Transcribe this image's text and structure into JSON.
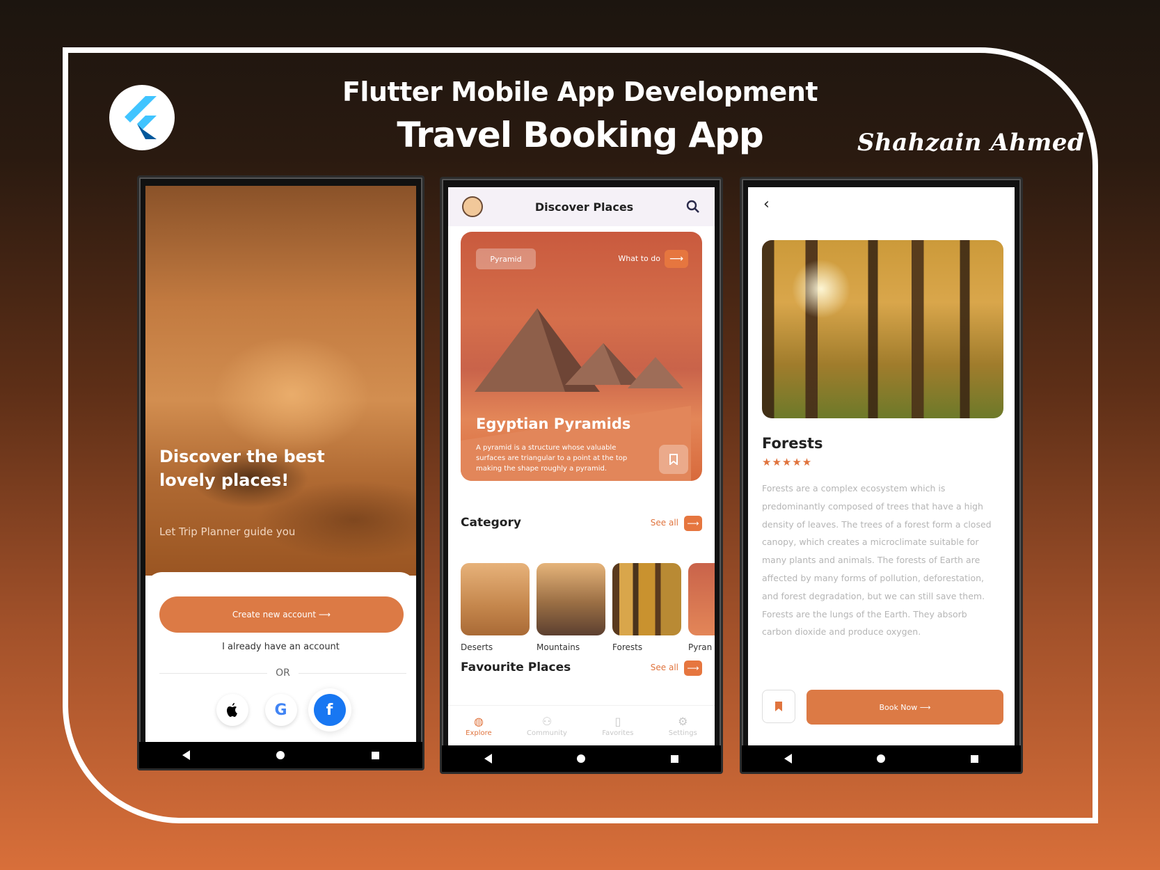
{
  "header": {
    "title_line1": "Flutter Mobile App Development",
    "title_line2": "Travel Booking App",
    "author": "Shahzain Ahmed",
    "logo_icon": "flutter-logo"
  },
  "phone1": {
    "headline": "Discover the best lovely places!",
    "subtitle": "Let Trip Planner guide you",
    "create_button": "Create new account ⟶",
    "have_account": "I already have an account",
    "or_label": "OR",
    "social": [
      {
        "name": "apple",
        "glyph": ""
      },
      {
        "name": "google",
        "glyph": "G"
      },
      {
        "name": "facebook",
        "glyph": "f"
      }
    ]
  },
  "phone2": {
    "title": "Discover Places",
    "hero": {
      "chip": "Pyramid",
      "what_to_do": "What to do",
      "title": "Egyptian Pyramids",
      "description": "A pyramid is a structure whose valuable surfaces are triangular to a point at the top making the shape roughly a pyramid."
    },
    "category_title": "Category",
    "see_all": "See all",
    "categories": [
      {
        "label": "Deserts",
        "color": "#c4864c"
      },
      {
        "label": "Mountains",
        "color": "#9a6e44"
      },
      {
        "label": "Forests",
        "color": "#b98a34"
      },
      {
        "label": "Pyran",
        "color": "#d36e4a"
      }
    ],
    "favourites_title": "Favourite Places",
    "tabs": [
      {
        "label": "Explore",
        "icon": "globe-icon",
        "active": true
      },
      {
        "label": "Community",
        "icon": "community-icon",
        "active": false
      },
      {
        "label": "Favorites",
        "icon": "bookmark-icon",
        "active": false
      },
      {
        "label": "Settings",
        "icon": "gear-icon",
        "active": false
      }
    ]
  },
  "phone3": {
    "title": "Forests",
    "stars": "★★★★★",
    "description": "Forests are a complex ecosystem which is predominantly composed of trees that have a high density of leaves. The trees of a forest form a closed canopy, which creates a microclimate suitable for many plants and animals. The forests of Earth are affected by many forms of pollution, deforestation, and forest degradation, but we can still save them. Forests are the lungs of the Earth. They absorb carbon dioxide and produce oxygen.",
    "book_button": "Book Now ⟶"
  },
  "colors": {
    "accent": "#dc7a45",
    "frame": "#ffffff"
  }
}
